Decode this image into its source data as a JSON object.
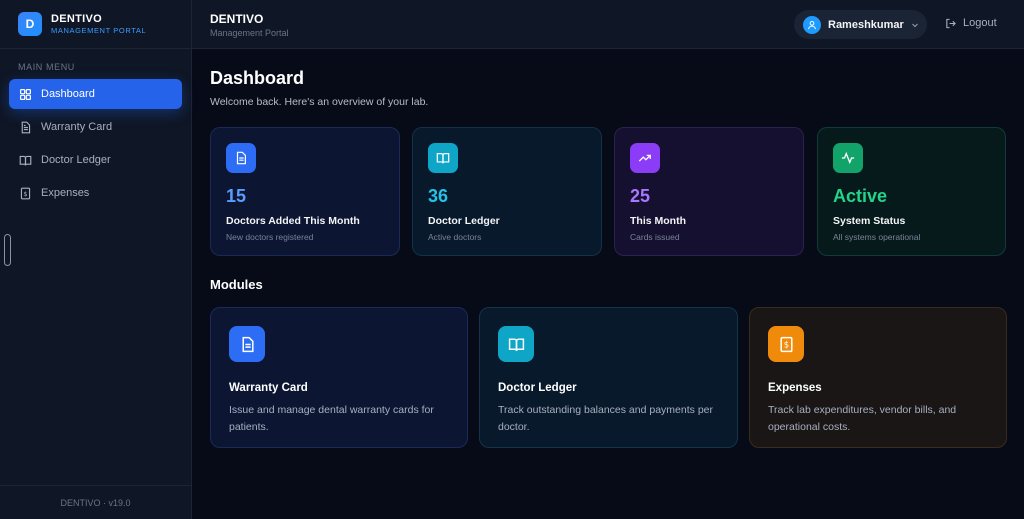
{
  "brand": {
    "logo_letter": "D",
    "name": "DENTIVO",
    "subtitle": "MANAGEMENT PORTAL"
  },
  "sidebar": {
    "menu_label": "MAIN MENU",
    "items": [
      {
        "label": "Dashboard",
        "icon": "grid-icon",
        "active": true
      },
      {
        "label": "Warranty Card",
        "icon": "document-icon",
        "active": false
      },
      {
        "label": "Doctor Ledger",
        "icon": "book-icon",
        "active": false
      },
      {
        "label": "Expenses",
        "icon": "receipt-icon",
        "active": false
      }
    ],
    "footer": "DENTIVO · v19.0"
  },
  "header": {
    "title": "DENTIVO",
    "subtitle": "Management Portal",
    "user_name": "Rameshkumar",
    "logout_label": "Logout"
  },
  "main": {
    "title": "Dashboard",
    "subtitle": "Welcome back. Here's an overview of your lab.",
    "stats": [
      {
        "value": "15",
        "label": "Doctors Added This Month",
        "sub": "New doctors registered",
        "icon": "document-icon",
        "color": "#2d6cf5"
      },
      {
        "value": "36",
        "label": "Doctor Ledger",
        "sub": "Active doctors",
        "icon": "book-icon",
        "color": "#0ea5c6"
      },
      {
        "value": "25",
        "label": "This Month",
        "sub": "Cards issued",
        "icon": "trending-up-icon",
        "color": "#8b3cf6"
      },
      {
        "value": "Active",
        "label": "System Status",
        "sub": "All systems operational",
        "icon": "activity-icon",
        "color": "#12a36b"
      }
    ],
    "modules_title": "Modules",
    "modules": [
      {
        "title": "Warranty Card",
        "description": "Issue and manage dental warranty cards for patients.",
        "icon": "document-icon",
        "color": "#2d6cf5"
      },
      {
        "title": "Doctor Ledger",
        "description": "Track outstanding balances and payments per doctor.",
        "icon": "book-icon",
        "color": "#0ea5c6"
      },
      {
        "title": "Expenses",
        "description": "Track lab expenditures, vendor bills, and operational costs.",
        "icon": "receipt-icon",
        "color": "#f08a0a"
      }
    ]
  }
}
